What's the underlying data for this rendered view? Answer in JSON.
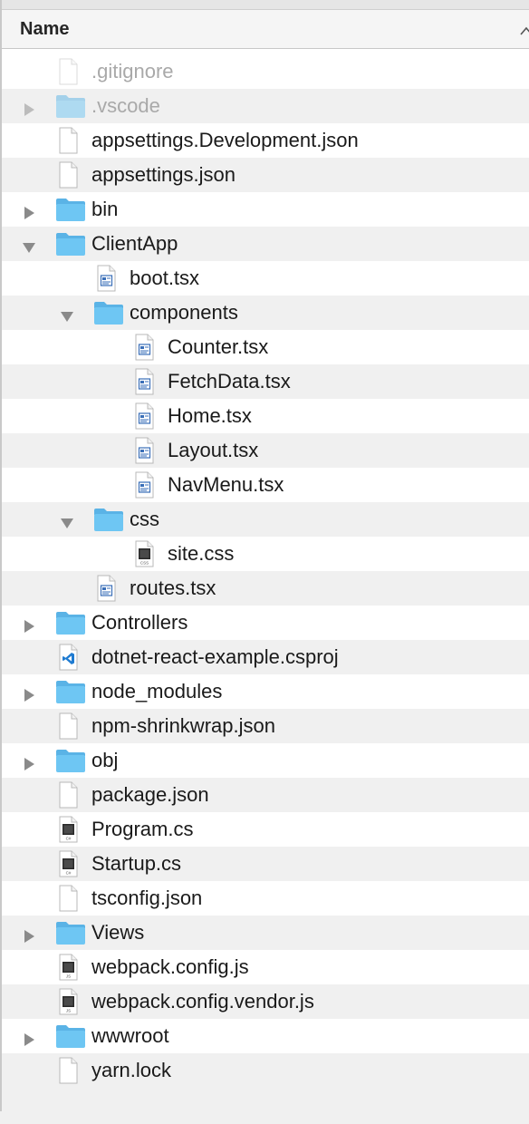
{
  "header": {
    "column_name": "Name"
  },
  "rows": [
    {
      "name": ".gitignore",
      "kind": "file",
      "icon": "file-icon",
      "depth": 0,
      "disclosure": "none",
      "dimmed": true
    },
    {
      "name": ".vscode",
      "kind": "folder",
      "icon": "folder-icon",
      "depth": 0,
      "disclosure": "collapsed",
      "dimmed": true
    },
    {
      "name": "appsettings.Development.json",
      "kind": "file",
      "icon": "file-icon",
      "depth": 0,
      "disclosure": "none"
    },
    {
      "name": "appsettings.json",
      "kind": "file",
      "icon": "file-icon",
      "depth": 0,
      "disclosure": "none"
    },
    {
      "name": "bin",
      "kind": "folder",
      "icon": "folder-icon",
      "depth": 0,
      "disclosure": "collapsed"
    },
    {
      "name": "ClientApp",
      "kind": "folder",
      "icon": "folder-icon",
      "depth": 0,
      "disclosure": "expanded"
    },
    {
      "name": "boot.tsx",
      "kind": "file",
      "icon": "tsx-file-icon",
      "depth": 1,
      "disclosure": "none"
    },
    {
      "name": "components",
      "kind": "folder",
      "icon": "folder-icon",
      "depth": 1,
      "disclosure": "expanded"
    },
    {
      "name": "Counter.tsx",
      "kind": "file",
      "icon": "tsx-file-icon",
      "depth": 2,
      "disclosure": "none"
    },
    {
      "name": "FetchData.tsx",
      "kind": "file",
      "icon": "tsx-file-icon",
      "depth": 2,
      "disclosure": "none"
    },
    {
      "name": "Home.tsx",
      "kind": "file",
      "icon": "tsx-file-icon",
      "depth": 2,
      "disclosure": "none"
    },
    {
      "name": "Layout.tsx",
      "kind": "file",
      "icon": "tsx-file-icon",
      "depth": 2,
      "disclosure": "none"
    },
    {
      "name": "NavMenu.tsx",
      "kind": "file",
      "icon": "tsx-file-icon",
      "depth": 2,
      "disclosure": "none"
    },
    {
      "name": "css",
      "kind": "folder",
      "icon": "folder-icon",
      "depth": 1,
      "disclosure": "expanded"
    },
    {
      "name": "site.css",
      "kind": "file",
      "icon": "css-file-icon",
      "depth": 2,
      "disclosure": "none",
      "badge": "CSS"
    },
    {
      "name": "routes.tsx",
      "kind": "file",
      "icon": "tsx-file-icon",
      "depth": 1,
      "disclosure": "none"
    },
    {
      "name": "Controllers",
      "kind": "folder",
      "icon": "folder-icon",
      "depth": 0,
      "disclosure": "collapsed"
    },
    {
      "name": "dotnet-react-example.csproj",
      "kind": "file",
      "icon": "vscode-file-icon",
      "depth": 0,
      "disclosure": "none"
    },
    {
      "name": "node_modules",
      "kind": "folder",
      "icon": "folder-icon",
      "depth": 0,
      "disclosure": "collapsed"
    },
    {
      "name": "npm-shrinkwrap.json",
      "kind": "file",
      "icon": "file-icon",
      "depth": 0,
      "disclosure": "none"
    },
    {
      "name": "obj",
      "kind": "folder",
      "icon": "folder-icon",
      "depth": 0,
      "disclosure": "collapsed"
    },
    {
      "name": "package.json",
      "kind": "file",
      "icon": "file-icon",
      "depth": 0,
      "disclosure": "none"
    },
    {
      "name": "Program.cs",
      "kind": "file",
      "icon": "cs-file-icon",
      "depth": 0,
      "disclosure": "none",
      "badge": "C#"
    },
    {
      "name": "Startup.cs",
      "kind": "file",
      "icon": "cs-file-icon",
      "depth": 0,
      "disclosure": "none",
      "badge": "C#"
    },
    {
      "name": "tsconfig.json",
      "kind": "file",
      "icon": "file-icon",
      "depth": 0,
      "disclosure": "none"
    },
    {
      "name": "Views",
      "kind": "folder",
      "icon": "folder-icon",
      "depth": 0,
      "disclosure": "collapsed"
    },
    {
      "name": "webpack.config.js",
      "kind": "file",
      "icon": "js-file-icon",
      "depth": 0,
      "disclosure": "none",
      "badge": "JS"
    },
    {
      "name": "webpack.config.vendor.js",
      "kind": "file",
      "icon": "js-file-icon",
      "depth": 0,
      "disclosure": "none",
      "badge": "JS"
    },
    {
      "name": "wwwroot",
      "kind": "folder",
      "icon": "folder-icon",
      "depth": 0,
      "disclosure": "collapsed"
    },
    {
      "name": "yarn.lock",
      "kind": "file",
      "icon": "file-icon",
      "depth": 0,
      "disclosure": "none"
    }
  ],
  "colors": {
    "folder": "#6ec6f3",
    "folder_tab": "#5ab3e6",
    "row_alt": "#f0f0f0",
    "disclosure": "#8a8a8a",
    "vscode_blue": "#1f7bd1"
  }
}
